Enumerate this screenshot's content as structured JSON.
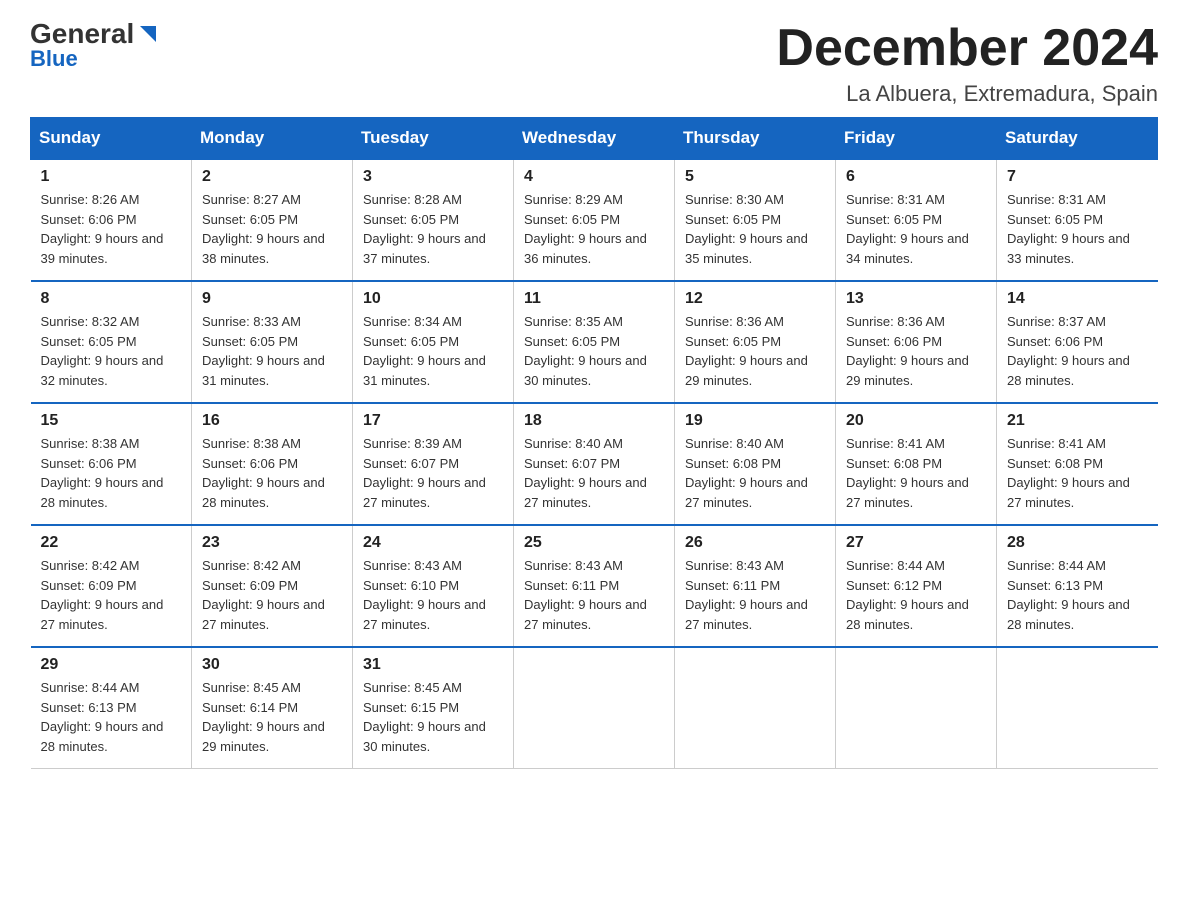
{
  "logo": {
    "general": "General",
    "triangle": "▶",
    "blue": "Blue"
  },
  "title": "December 2024",
  "location": "La Albuera, Extremadura, Spain",
  "days_header": [
    "Sunday",
    "Monday",
    "Tuesday",
    "Wednesday",
    "Thursday",
    "Friday",
    "Saturday"
  ],
  "weeks": [
    [
      {
        "day": "1",
        "sunrise": "8:26 AM",
        "sunset": "6:06 PM",
        "daylight": "9 hours and 39 minutes."
      },
      {
        "day": "2",
        "sunrise": "8:27 AM",
        "sunset": "6:05 PM",
        "daylight": "9 hours and 38 minutes."
      },
      {
        "day": "3",
        "sunrise": "8:28 AM",
        "sunset": "6:05 PM",
        "daylight": "9 hours and 37 minutes."
      },
      {
        "day": "4",
        "sunrise": "8:29 AM",
        "sunset": "6:05 PM",
        "daylight": "9 hours and 36 minutes."
      },
      {
        "day": "5",
        "sunrise": "8:30 AM",
        "sunset": "6:05 PM",
        "daylight": "9 hours and 35 minutes."
      },
      {
        "day": "6",
        "sunrise": "8:31 AM",
        "sunset": "6:05 PM",
        "daylight": "9 hours and 34 minutes."
      },
      {
        "day": "7",
        "sunrise": "8:31 AM",
        "sunset": "6:05 PM",
        "daylight": "9 hours and 33 minutes."
      }
    ],
    [
      {
        "day": "8",
        "sunrise": "8:32 AM",
        "sunset": "6:05 PM",
        "daylight": "9 hours and 32 minutes."
      },
      {
        "day": "9",
        "sunrise": "8:33 AM",
        "sunset": "6:05 PM",
        "daylight": "9 hours and 31 minutes."
      },
      {
        "day": "10",
        "sunrise": "8:34 AM",
        "sunset": "6:05 PM",
        "daylight": "9 hours and 31 minutes."
      },
      {
        "day": "11",
        "sunrise": "8:35 AM",
        "sunset": "6:05 PM",
        "daylight": "9 hours and 30 minutes."
      },
      {
        "day": "12",
        "sunrise": "8:36 AM",
        "sunset": "6:05 PM",
        "daylight": "9 hours and 29 minutes."
      },
      {
        "day": "13",
        "sunrise": "8:36 AM",
        "sunset": "6:06 PM",
        "daylight": "9 hours and 29 minutes."
      },
      {
        "day": "14",
        "sunrise": "8:37 AM",
        "sunset": "6:06 PM",
        "daylight": "9 hours and 28 minutes."
      }
    ],
    [
      {
        "day": "15",
        "sunrise": "8:38 AM",
        "sunset": "6:06 PM",
        "daylight": "9 hours and 28 minutes."
      },
      {
        "day": "16",
        "sunrise": "8:38 AM",
        "sunset": "6:06 PM",
        "daylight": "9 hours and 28 minutes."
      },
      {
        "day": "17",
        "sunrise": "8:39 AM",
        "sunset": "6:07 PM",
        "daylight": "9 hours and 27 minutes."
      },
      {
        "day": "18",
        "sunrise": "8:40 AM",
        "sunset": "6:07 PM",
        "daylight": "9 hours and 27 minutes."
      },
      {
        "day": "19",
        "sunrise": "8:40 AM",
        "sunset": "6:08 PM",
        "daylight": "9 hours and 27 minutes."
      },
      {
        "day": "20",
        "sunrise": "8:41 AM",
        "sunset": "6:08 PM",
        "daylight": "9 hours and 27 minutes."
      },
      {
        "day": "21",
        "sunrise": "8:41 AM",
        "sunset": "6:08 PM",
        "daylight": "9 hours and 27 minutes."
      }
    ],
    [
      {
        "day": "22",
        "sunrise": "8:42 AM",
        "sunset": "6:09 PM",
        "daylight": "9 hours and 27 minutes."
      },
      {
        "day": "23",
        "sunrise": "8:42 AM",
        "sunset": "6:09 PM",
        "daylight": "9 hours and 27 minutes."
      },
      {
        "day": "24",
        "sunrise": "8:43 AM",
        "sunset": "6:10 PM",
        "daylight": "9 hours and 27 minutes."
      },
      {
        "day": "25",
        "sunrise": "8:43 AM",
        "sunset": "6:11 PM",
        "daylight": "9 hours and 27 minutes."
      },
      {
        "day": "26",
        "sunrise": "8:43 AM",
        "sunset": "6:11 PM",
        "daylight": "9 hours and 27 minutes."
      },
      {
        "day": "27",
        "sunrise": "8:44 AM",
        "sunset": "6:12 PM",
        "daylight": "9 hours and 28 minutes."
      },
      {
        "day": "28",
        "sunrise": "8:44 AM",
        "sunset": "6:13 PM",
        "daylight": "9 hours and 28 minutes."
      }
    ],
    [
      {
        "day": "29",
        "sunrise": "8:44 AM",
        "sunset": "6:13 PM",
        "daylight": "9 hours and 28 minutes."
      },
      {
        "day": "30",
        "sunrise": "8:45 AM",
        "sunset": "6:14 PM",
        "daylight": "9 hours and 29 minutes."
      },
      {
        "day": "31",
        "sunrise": "8:45 AM",
        "sunset": "6:15 PM",
        "daylight": "9 hours and 30 minutes."
      },
      null,
      null,
      null,
      null
    ]
  ]
}
